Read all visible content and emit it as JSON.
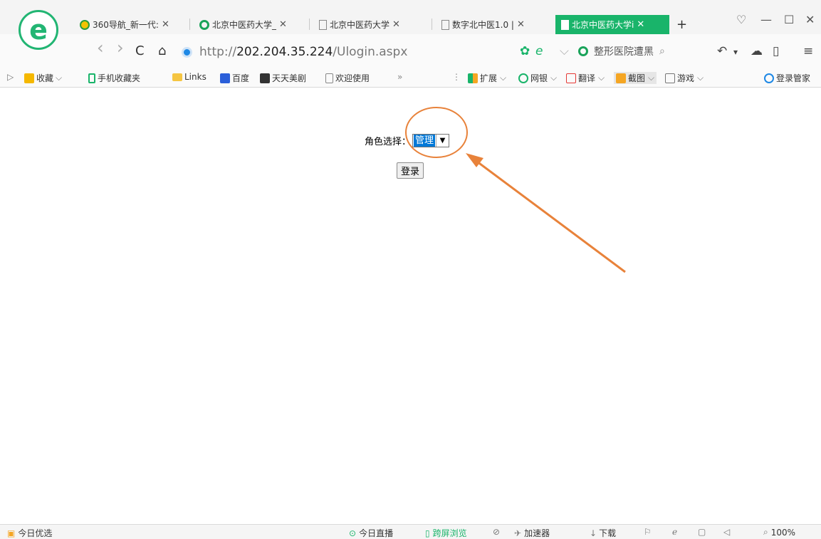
{
  "browser": {
    "tabs": [
      {
        "title": "360导航_新一代:",
        "icon": "360-nav-icon"
      },
      {
        "title": "北京中医药大学_",
        "icon": "360-search-icon"
      },
      {
        "title": "北京中医药大学",
        "icon": "page-icon"
      },
      {
        "title": "数字北中医1.0 |",
        "icon": "page-icon"
      },
      {
        "title": "北京中医药大学i",
        "icon": "page-icon",
        "active": true
      }
    ],
    "close_glyph": "✕",
    "new_tab": "+",
    "window_controls": {
      "skin": "♡",
      "minimize": "—",
      "maximize": "☐",
      "close": "✕"
    },
    "accent_color": "#19b46a"
  },
  "address_bar": {
    "url_prefix": "http://",
    "url_host": "202.204.35.224",
    "url_path": "/Ulogin.aspx",
    "search_placeholder": "整形医院遭黑",
    "back": "‹",
    "forward": "›",
    "refresh": "C",
    "home": "⌂",
    "menu": "≡"
  },
  "favorites": [
    {
      "label": "收藏",
      "icon": "star-folder-icon",
      "dropdown": true
    },
    {
      "label": "手机收藏夹",
      "icon": "mobile-icon"
    },
    {
      "label": "Links",
      "icon": "folder-icon"
    },
    {
      "label": "百度",
      "icon": "baidu-icon"
    },
    {
      "label": "天天美剧",
      "icon": "tv-icon"
    },
    {
      "label": "欢迎使用",
      "icon": "page-icon"
    }
  ],
  "favorites_more": "»",
  "extensions": [
    {
      "label": "扩展",
      "icon": "grid-icon"
    },
    {
      "label": "网银",
      "icon": "bank-icon"
    },
    {
      "label": "翻译",
      "icon": "translate-icon"
    },
    {
      "label": "截图",
      "icon": "scissors-icon"
    },
    {
      "label": "游戏",
      "icon": "game-icon"
    },
    {
      "label": "登录管家",
      "icon": "key-icon"
    }
  ],
  "page": {
    "role_label": "角色选择：",
    "role_selected": "管理",
    "login_button": "登录"
  },
  "status_bar": {
    "left": "今日优选",
    "live": "今日直播",
    "cross_screen": "跨屏浏览",
    "accelerator": "加速器",
    "download": "下载",
    "zoom": "100%"
  }
}
